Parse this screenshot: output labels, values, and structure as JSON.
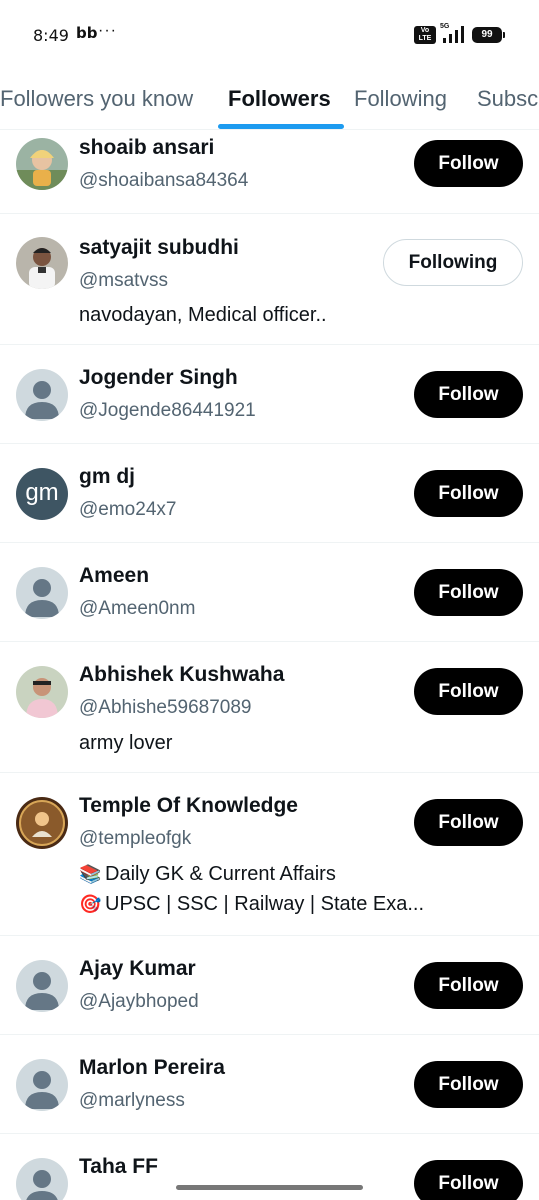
{
  "status_bar": {
    "time": "8:49",
    "extra": "bb",
    "dots": "···",
    "volte": "Vo LTE",
    "network": "5G",
    "battery": "99"
  },
  "tabs": [
    {
      "label": "Followers you know"
    },
    {
      "label": "Followers"
    },
    {
      "label": "Following"
    },
    {
      "label": "Subscriptions"
    }
  ],
  "active_tab": "Followers",
  "users": [
    {
      "name": "shoaib ansari",
      "handle": "@shoaibansa84364",
      "bio": "",
      "button": "Follow",
      "avatar": "photo-child"
    },
    {
      "name": "satyajit subudhi",
      "handle": "@msatvss",
      "bio": "navodayan, Medical officer..",
      "button": "Following",
      "avatar": "photo-man"
    },
    {
      "name": "Jogender Singh",
      "handle": "@Jogende86441921",
      "bio": "",
      "button": "Follow",
      "avatar": "default"
    },
    {
      "name": "gm dj",
      "handle": "@emo24x7",
      "bio": "",
      "button": "Follow",
      "avatar": "initials",
      "initials": "gm"
    },
    {
      "name": "Ameen",
      "handle": "@Ameen0nm",
      "bio": "",
      "button": "Follow",
      "avatar": "default"
    },
    {
      "name": "Abhishek Kushwaha",
      "handle": "@Abhishe59687089",
      "bio": "army lover",
      "button": "Follow",
      "avatar": "photo-man-2"
    },
    {
      "name": "Temple Of Knowledge",
      "handle": "@templeofgk",
      "bio_lines": [
        "Daily GK & Current Affairs",
        "UPSC | SSC | Railway | State Exa..."
      ],
      "bio_emojis": [
        "books-icon",
        "target-icon"
      ],
      "button": "Follow",
      "avatar": "logo-temple"
    },
    {
      "name": "Ajay Kumar",
      "handle": "@Ajaybhoped",
      "bio": "",
      "button": "Follow",
      "avatar": "default"
    },
    {
      "name": "Marlon Pereira",
      "handle": "@marlyness",
      "bio": "",
      "button": "Follow",
      "avatar": "default"
    },
    {
      "name": "Taha FF",
      "handle": "",
      "bio": "",
      "button": "Follow",
      "avatar": "default"
    }
  ]
}
